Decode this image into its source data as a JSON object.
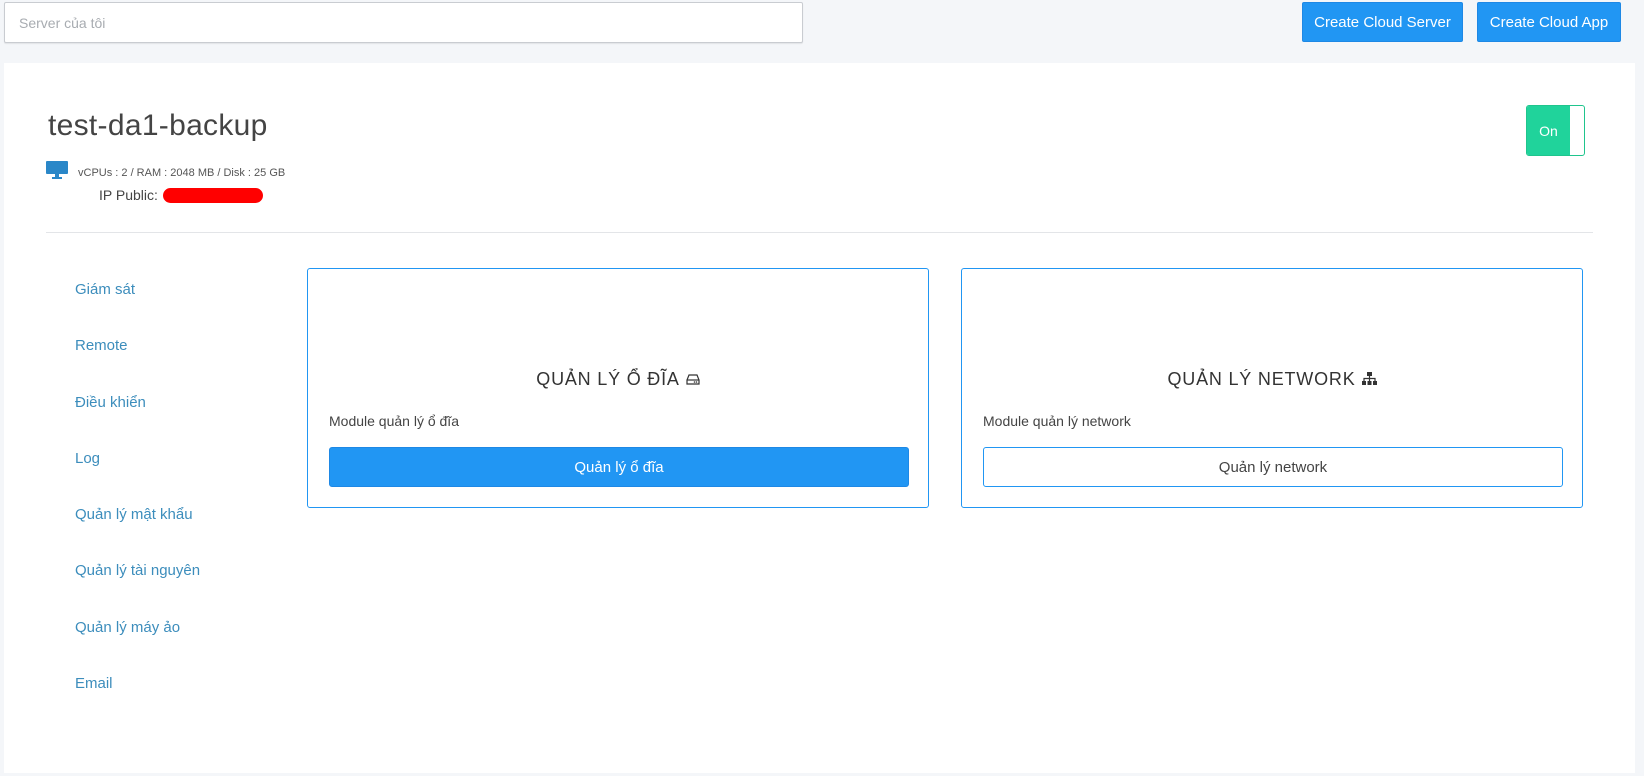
{
  "search": {
    "placeholder": "Server của tôi"
  },
  "toolbar": {
    "create_cloud_server": "Create Cloud Server",
    "create_cloud_app": "Create Cloud App"
  },
  "server": {
    "name": "test-da1-backup",
    "specs": "vCPUs : 2 / RAM : 2048 MB / Disk : 25 GB",
    "ip_label": "IP Public:",
    "power_state": "On"
  },
  "sidebar": {
    "items": [
      {
        "label": "Giám sát"
      },
      {
        "label": "Remote"
      },
      {
        "label": "Điều khiển"
      },
      {
        "label": "Log"
      },
      {
        "label": "Quản lý mật khẩu"
      },
      {
        "label": "Quản lý tài nguyên"
      },
      {
        "label": "Quản lý máy ảo"
      },
      {
        "label": "Email"
      }
    ]
  },
  "cards": {
    "disk": {
      "title": "QUẢN LÝ Ổ ĐĨA",
      "description": "Module quản lý ổ đĩa",
      "button": "Quản lý ổ đĩa",
      "icon": "hdd-icon"
    },
    "network": {
      "title": "QUẢN LÝ NETWORK",
      "description": "Module quản lý network",
      "button": "Quản lý network",
      "icon": "sitemap-icon"
    }
  },
  "colors": {
    "accent": "#2196f3",
    "link": "#3c8dbc",
    "toggle_on": "#20d39b",
    "redaction": "#ff0000"
  }
}
